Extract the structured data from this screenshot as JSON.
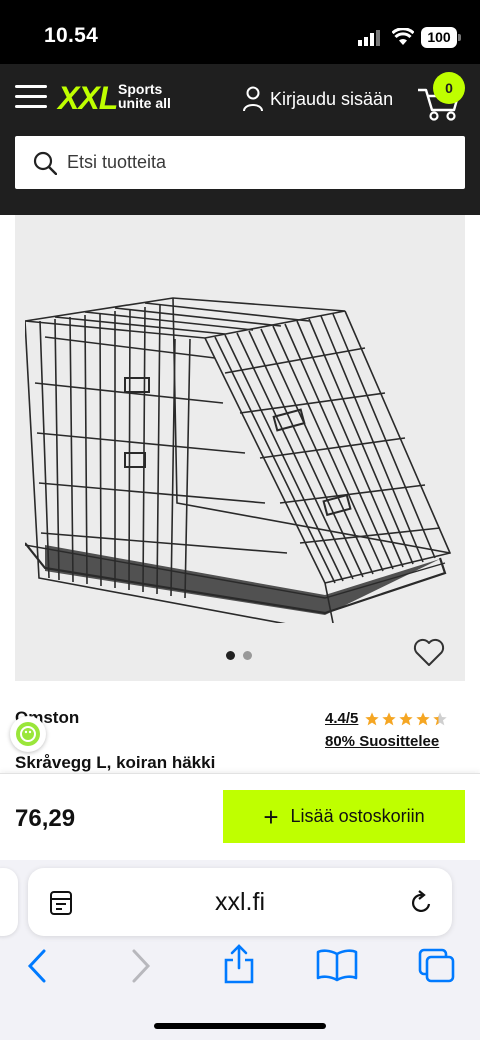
{
  "status_bar": {
    "time": "10.54",
    "battery": "100",
    "icons": [
      "signal-icon",
      "wifi-icon",
      "battery-icon"
    ]
  },
  "header": {
    "logo": {
      "name": "XXL",
      "tagline_line1": "Sports",
      "tagline_line2": "unite all"
    },
    "login_label": "Kirjaudu sisään",
    "cart_count": "0",
    "icons": [
      "menu-icon",
      "user-icon",
      "cart-icon"
    ]
  },
  "search": {
    "placeholder": "Etsi tuotteita",
    "icon": "search-icon"
  },
  "product": {
    "image_dots": 2,
    "active_dot": 1,
    "brand": "Omston",
    "name": "Skråvegg L, koiran häkki",
    "rating": "4.4/5",
    "rating_score": 4.4,
    "rating_max": 5,
    "recommend": "80% Suosittelee",
    "price": "76,29",
    "add_to_cart": "Lisää ostoskoriin"
  },
  "browser": {
    "url": "xxl.fi",
    "icons": [
      "reader-icon",
      "reload-icon",
      "back-icon",
      "forward-icon",
      "share-icon",
      "bookmarks-icon",
      "tabs-icon"
    ]
  },
  "colors": {
    "accent": "#bfff00",
    "header_bg": "#1f1f1f",
    "image_bg": "#ececec",
    "star": "#f5a623",
    "ios_blue": "#007aff"
  }
}
